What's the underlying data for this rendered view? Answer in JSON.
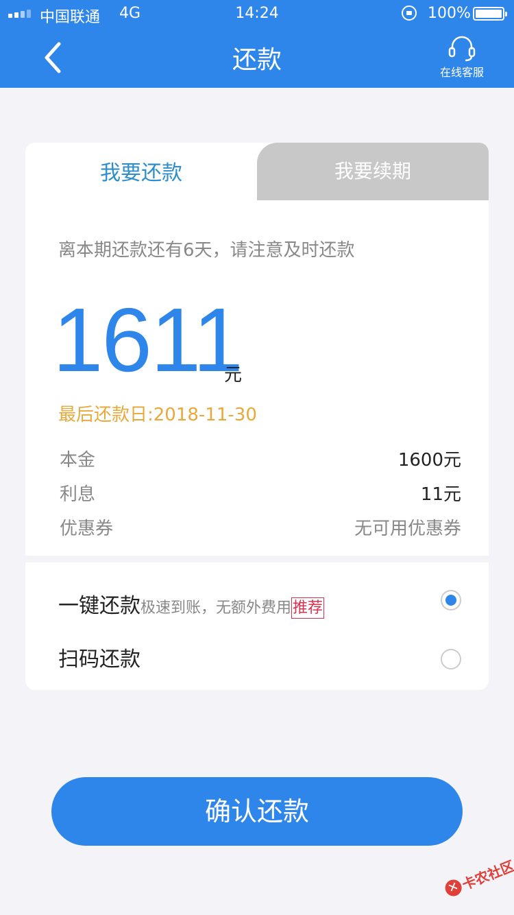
{
  "status_bar": {
    "carrier": "中国联通",
    "network": "4G",
    "time": "14:24",
    "battery": "100%"
  },
  "header": {
    "title": "还款",
    "service_label": "在线客服"
  },
  "tabs": [
    {
      "label": "我要还款",
      "active": true
    },
    {
      "label": "我要续期",
      "active": false
    }
  ],
  "repayment": {
    "notice": "离本期还款还有6天，请注意及时还款",
    "amount": "1611",
    "amount_unit": "元",
    "due_date": "最后还款日:2018-11-30",
    "details": [
      {
        "label": "本金",
        "value": "1600元"
      },
      {
        "label": "利息",
        "value": "11元"
      },
      {
        "label": "优惠券",
        "value": "无可用优惠券"
      }
    ]
  },
  "methods": [
    {
      "label": "一键还款",
      "hint": "极速到账，无额外费用",
      "tag": "推荐",
      "selected": true
    },
    {
      "label": "扫码还款",
      "hint": "",
      "tag": "",
      "selected": false
    }
  ],
  "confirm_label": "确认还款",
  "watermark": "卡农社区",
  "colors": {
    "primary": "#2f86ea",
    "due": "#e9a93a",
    "tag": "#d9304f"
  }
}
